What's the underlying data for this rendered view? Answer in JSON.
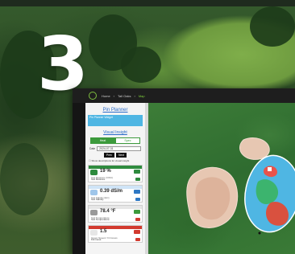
{
  "step_number": "3",
  "app": {
    "breadcrumbs": [
      "Home",
      "Tall Oaks",
      "Map"
    ],
    "panel_title": "Pin Planner",
    "planner_text": "Pin Planner Widget",
    "visual_insight_title": "Visual Insight",
    "toggle": {
      "left": "Heat",
      "right": "Spec"
    },
    "date_label": "Date",
    "date_value": "2024-07-31",
    "nav": [
      "Prev",
      "Next"
    ],
    "checkbox_label": "Show descriptions for visual insight",
    "cards": [
      {
        "value": "19 %",
        "label": "Soil Moisture (VWC)",
        "footer": "Soil Moisture",
        "accent": "#2e8b3e"
      },
      {
        "value": "0.39 dS/m",
        "label": "Soil Salinity (EC)",
        "footer": "Soil Salinity",
        "accent": "#2f78c4"
      },
      {
        "value": "78.4 °F",
        "label": "Soil Temperature",
        "footer": "Soil Temperature",
        "accent": "#3b3b3b"
      },
      {
        "value": "1.5",
        "label": "Green Speed / Firmness",
        "footer": "Firmness",
        "accent": "#d23a2f"
      }
    ]
  },
  "colors": {
    "header_bg": "#1e1e1e",
    "accent_green": "#7fd13b",
    "accent_blue": "#4fb6e3",
    "sand": "#e7c7b2",
    "water_blue": "#4fb6e3"
  }
}
